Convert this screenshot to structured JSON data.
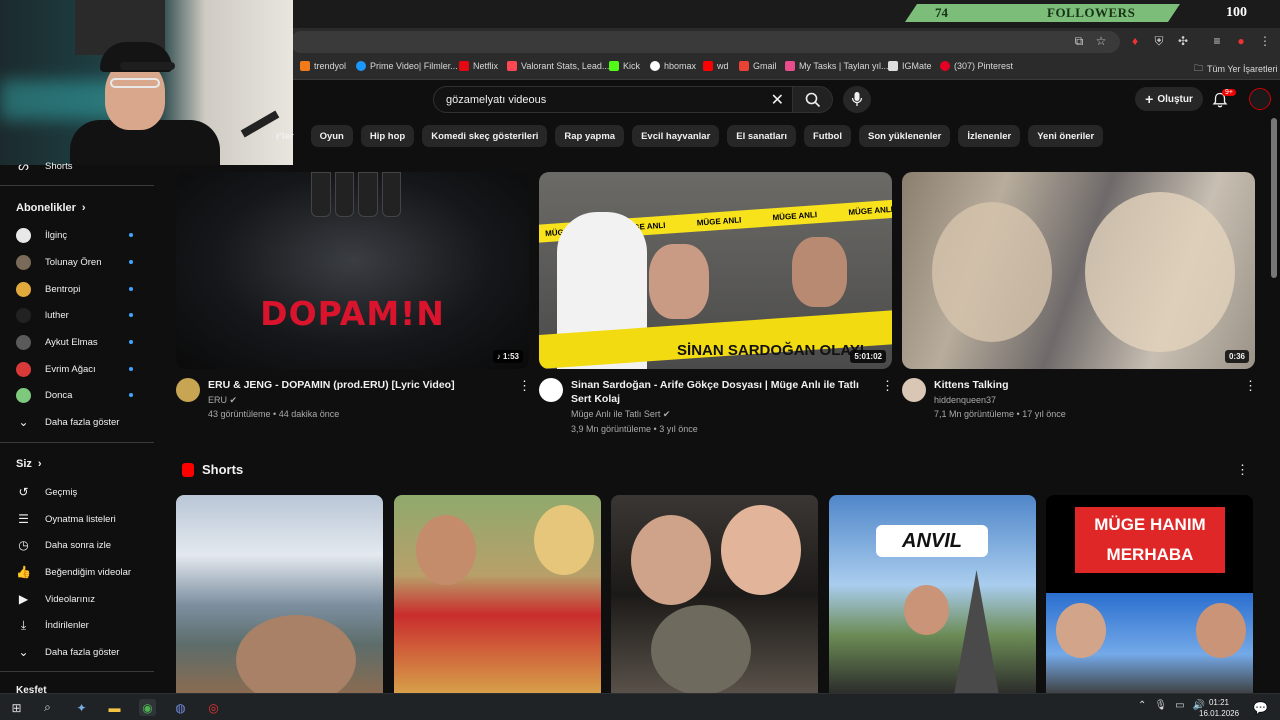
{
  "overlay": {
    "followers_count": "74",
    "followers_label": "FOLLOWERS",
    "goal": "100"
  },
  "bookmarks": [
    {
      "label": "trendyol",
      "color": "#f27a1a"
    },
    {
      "label": "Prime Video| Filmler...",
      "color": "#1a98ff"
    },
    {
      "label": "Netflix",
      "color": "#e50914"
    },
    {
      "label": "Valorant Stats, Lead...",
      "color": "#ff4655"
    },
    {
      "label": "Kick",
      "color": "#53fc18"
    },
    {
      "label": "hbomax",
      "color": "#ffffff"
    },
    {
      "label": "wd",
      "color": "#ff0000"
    },
    {
      "label": "Gmail",
      "color": "#ea4335"
    },
    {
      "label": "My Tasks | Taylan yıl...",
      "color": "#e84c8a"
    },
    {
      "label": "IGMate",
      "color": "#dddddd"
    },
    {
      "label": "(307) Pinterest",
      "color": "#e60023"
    }
  ],
  "bookmarks_all": "Tüm Yer İşaretleri",
  "search": {
    "query": "gözamelyatı videous"
  },
  "header": {
    "create_label": "Oluştur",
    "notif_badge": "9+"
  },
  "chips": [
    "r'ler",
    "Oyun",
    "Hip hop",
    "Komedi skeç gösterileri",
    "Rap yapma",
    "Evcil hayvanlar",
    "El sanatları",
    "Futbol",
    "Son yüklenenler",
    "İzlenenler",
    "Yeni öneriler"
  ],
  "sidebar": {
    "shorts": "Shorts",
    "subs_title": "Abonelikler",
    "subs": [
      {
        "label": "İlginç",
        "color": "#e8e8e8"
      },
      {
        "label": "Tolunay Ören",
        "color": "#7a6a5a"
      },
      {
        "label": "Bentropi",
        "color": "#e0a93b"
      },
      {
        "label": "luther",
        "color": "#222222"
      },
      {
        "label": "Aykut Elmas",
        "color": "#5a5a5a"
      },
      {
        "label": "Evrim Ağacı",
        "color": "#d83a3a"
      },
      {
        "label": "Donca",
        "color": "#7fc97f"
      }
    ],
    "show_more_subs": "Daha fazla göster",
    "you_title": "Siz",
    "you": [
      "Geçmiş",
      "Oynatma listeleri",
      "Daha sonra izle",
      "Beğendiğim videolar",
      "Videolarınız",
      "İndirilenler",
      "Daha fazla göster"
    ],
    "explore_title": "Keşfet"
  },
  "videos": [
    {
      "title": "ERU & JENG - DOPAMIN (prod.ERU) [Lyric Video]",
      "channel": "ERU",
      "meta": "43 görüntüleme • 44 dakika önce",
      "duration": "1:53",
      "thumb_text": "DOPAM!N"
    },
    {
      "title": "Sinan Sardoğan - Arife Gökçe Dosyası | Müge Anlı ile Tatlı Sert Kolaj",
      "channel": "Müge Anlı ile Tatlı Sert",
      "meta": "3,9 Mn görüntüleme • 3 yıl önce",
      "duration": "5:01:02",
      "thumb_text": "SİNAN SARDOĞAN OLAYI",
      "tape": "MÜGE ANLI"
    },
    {
      "title": "Kittens Talking",
      "channel": "hiddenqueen37",
      "meta": "7,1 Mn görüntüleme • 17 yıl önce",
      "duration": "0:36"
    }
  ],
  "shorts": {
    "title": "Shorts",
    "anvil": "ANVIL",
    "muge": "MÜGE HANIM MERHABA"
  },
  "taskbar": {
    "time": "01:21",
    "date": "16.01.2026"
  }
}
